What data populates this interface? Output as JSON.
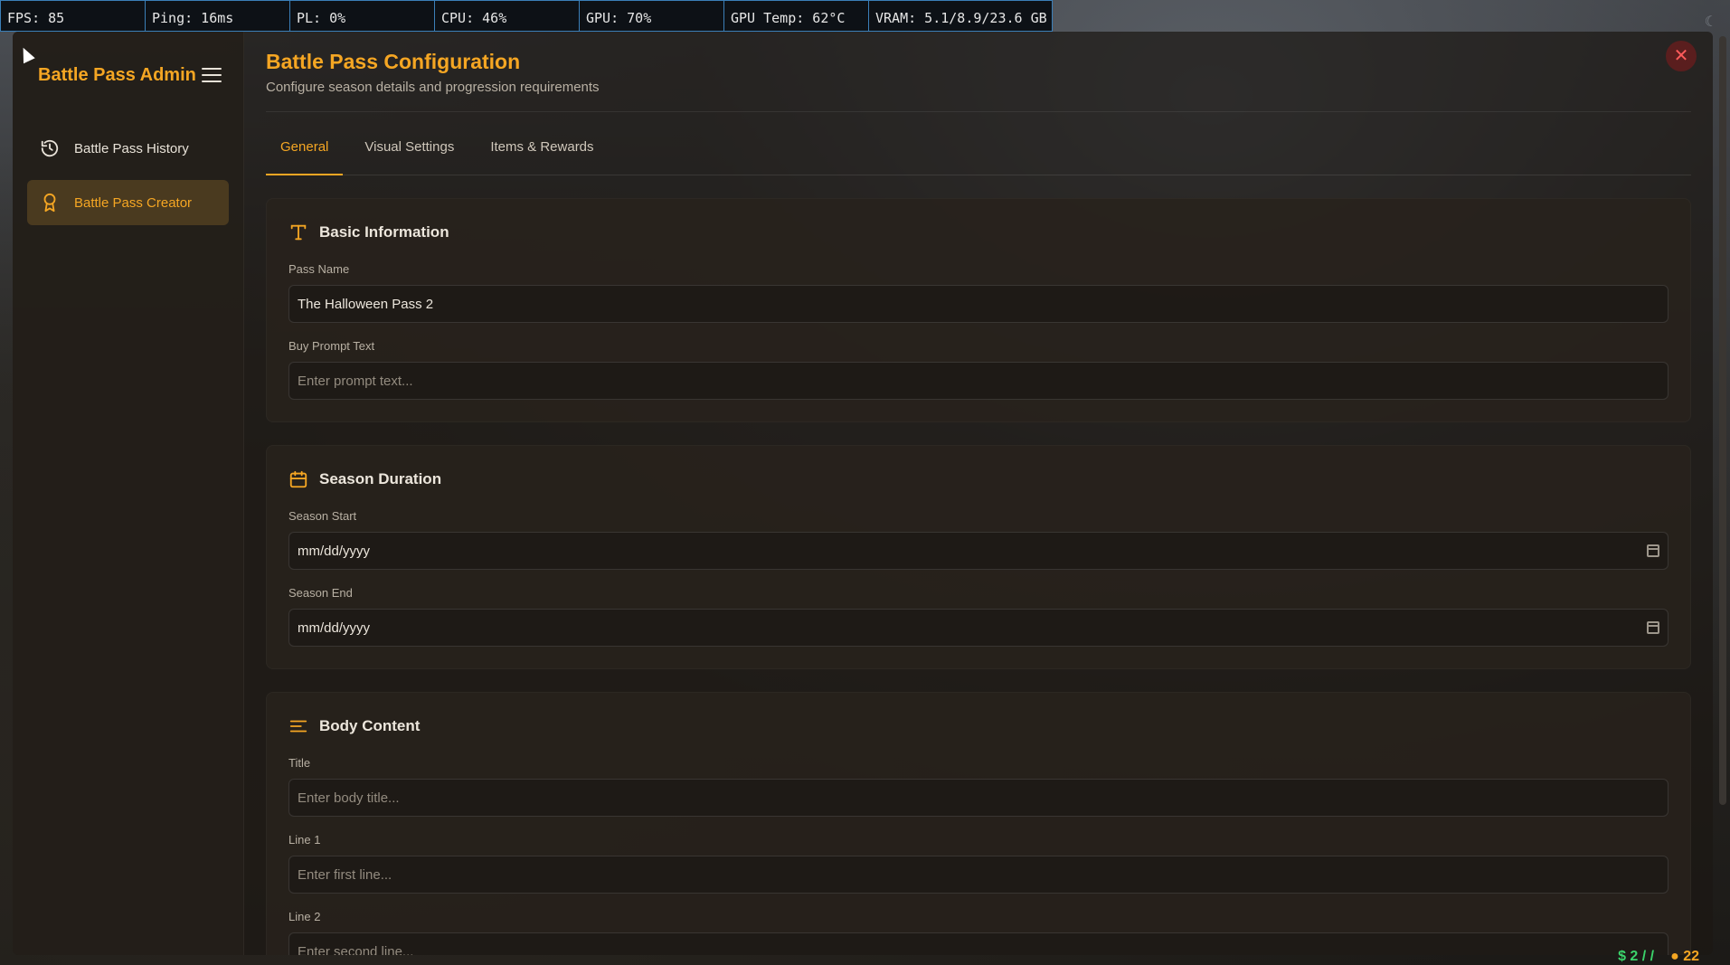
{
  "perf": {
    "fps": "FPS: 85",
    "ping": "Ping: 16ms",
    "pl": "PL: 0%",
    "cpu": "CPU: 46%",
    "gpu": "GPU: 70%",
    "gpu_temp": "GPU Temp: 62°C",
    "vram": "VRAM: 5.1/8.9/23.6 GB"
  },
  "sidebar": {
    "brand": "Battle Pass Admin",
    "items": [
      {
        "label": "Battle Pass History",
        "icon": "history-icon",
        "active": false
      },
      {
        "label": "Battle Pass Creator",
        "icon": "award-icon",
        "active": true
      }
    ]
  },
  "header": {
    "title": "Battle Pass Configuration",
    "subtitle": "Configure season details and progression requirements"
  },
  "tabs": [
    {
      "label": "General",
      "active": true
    },
    {
      "label": "Visual Settings",
      "active": false
    },
    {
      "label": "Items & Rewards",
      "active": false
    }
  ],
  "basic_info": {
    "title": "Basic Information",
    "pass_name_label": "Pass Name",
    "pass_name_value": "The Halloween Pass 2",
    "buy_prompt_label": "Buy Prompt Text",
    "buy_prompt_placeholder": "Enter prompt text..."
  },
  "season_duration": {
    "title": "Season Duration",
    "start_label": "Season Start",
    "start_value": "mm/dd/yyyy",
    "end_label": "Season End",
    "end_value": "mm/dd/yyyy"
  },
  "body_content": {
    "title": "Body Content",
    "title_label": "Title",
    "title_placeholder": "Enter body title...",
    "line1_label": "Line 1",
    "line1_placeholder": "Enter first line...",
    "line2_label": "Line 2",
    "line2_placeholder": "Enter second line..."
  },
  "hud": {
    "cash": "2 / /",
    "coins": "22"
  },
  "colors": {
    "accent": "#f5a623",
    "close": "#ff5b5b"
  }
}
